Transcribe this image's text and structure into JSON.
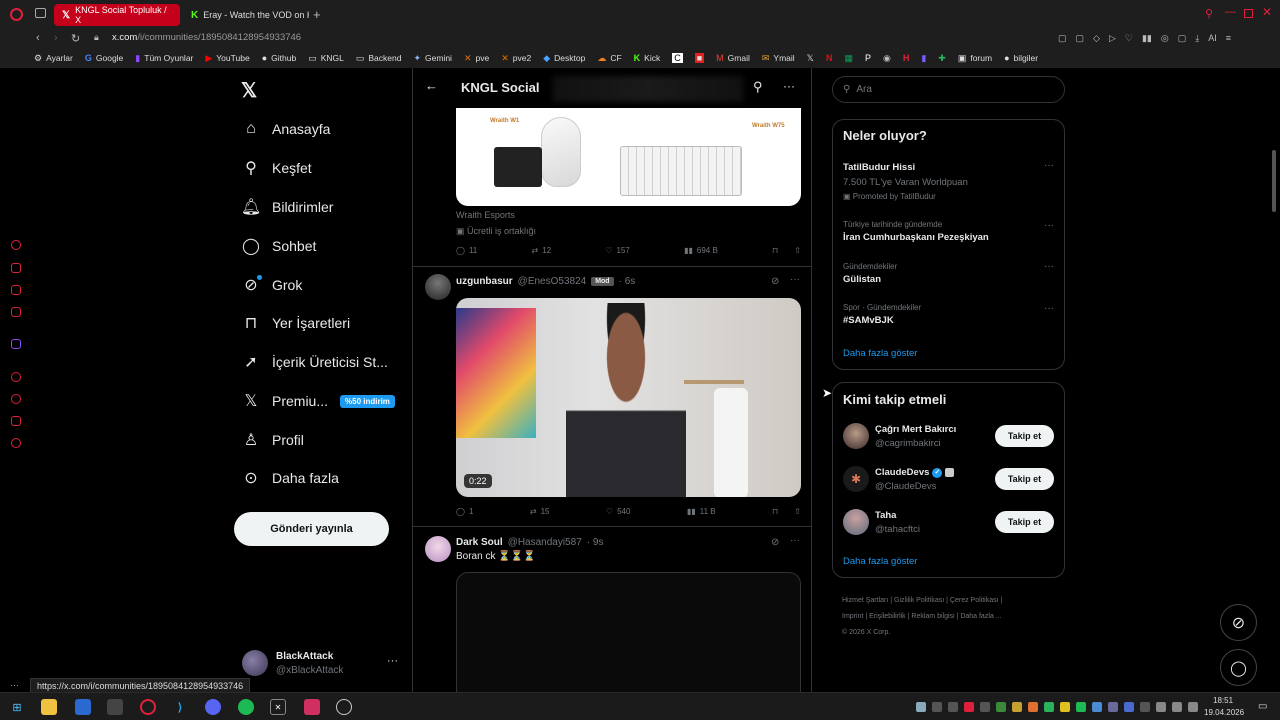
{
  "browser": {
    "tabs": [
      {
        "label": "KNGL Social Topluluk / X",
        "icon": "x-icon"
      },
      {
        "label": "Eray - Watch the VOD on K",
        "icon": "kick-icon"
      }
    ],
    "url_host": "x.com",
    "url_path": "/i/communities/1895084128954933746",
    "status_url": "https://x.com/i/communities/1895084128954933746",
    "bookmarks": [
      {
        "label": "Ayarlar",
        "icon": "gear-icon"
      },
      {
        "label": "Google",
        "icon": "google-icon"
      },
      {
        "label": "Tüm Oyunlar",
        "icon": "twitch-icon"
      },
      {
        "label": "YouTube",
        "icon": "youtube-icon"
      },
      {
        "label": "Github",
        "icon": "github-icon"
      },
      {
        "label": "KNGL",
        "icon": "folder-icon"
      },
      {
        "label": "Backend",
        "icon": "folder-icon"
      },
      {
        "label": "Gemini",
        "icon": "gemini-icon"
      },
      {
        "label": "pve",
        "icon": "proxmox-icon"
      },
      {
        "label": "pve2",
        "icon": "proxmox-icon"
      },
      {
        "label": "Desktop",
        "icon": "desktop-icon"
      },
      {
        "label": "CF",
        "icon": "cloudflare-icon"
      },
      {
        "label": "Kick",
        "icon": "kick-icon"
      },
      {
        "label": "Gmail",
        "icon": "gmail-icon"
      },
      {
        "label": "Ymail",
        "icon": "mail-icon"
      },
      {
        "label": "forum",
        "icon": "forum-icon"
      },
      {
        "label": "bilgiler",
        "icon": "github-icon"
      }
    ],
    "toolbar_ai": "AI"
  },
  "nav": {
    "items": [
      {
        "label": "Anasayfa",
        "icon": "home-icon"
      },
      {
        "label": "Keşfet",
        "icon": "search-icon"
      },
      {
        "label": "Bildirimler",
        "icon": "bell-icon"
      },
      {
        "label": "Sohbet",
        "icon": "chat-icon"
      },
      {
        "label": "Grok",
        "icon": "grok-icon"
      },
      {
        "label": "Yer İşaretleri",
        "icon": "bookmark-icon"
      },
      {
        "label": "İçerik Üreticisi St...",
        "icon": "rocket-icon"
      },
      {
        "label": "Premiu...",
        "icon": "x-logo-icon"
      },
      {
        "label": "Profil",
        "icon": "person-icon"
      },
      {
        "label": "Daha fazla",
        "icon": "more-icon"
      }
    ],
    "premium_badge": "%50 indirim",
    "post_button": "Gönderi yayınla",
    "account": {
      "name": "BlackAttack",
      "handle": "@xBlackAttack"
    }
  },
  "header": {
    "title": "KNGL Social"
  },
  "tweets": [
    {
      "ad_labels": [
        "Wraith W1",
        "Wraith W75"
      ],
      "author": "Wraith Esports",
      "paid": "Ücretli iş ortaklığı",
      "replies": "11",
      "retweets": "12",
      "likes": "157",
      "views": "694 B"
    },
    {
      "author": "uzgunbasur",
      "handle": "@EnesO53824",
      "badge": "Mod",
      "time": "· 6s",
      "video_duration": "0:22",
      "replies": "1",
      "retweets": "15",
      "likes": "540",
      "views": "11 B"
    },
    {
      "author": "Dark Soul",
      "handle": "@Hasandayi587",
      "time": "· 9s",
      "text": "Boran ck ⏳⏳⏳"
    }
  ],
  "right": {
    "search_placeholder": "Ara",
    "trends_title": "Neler oluyor?",
    "trends": [
      {
        "sub": "7.500 TL'ye Varan Worldpuan",
        "name": "TatilBudur Hissi",
        "promo": "Promoted by TatilBudur"
      },
      {
        "sub": "Türkiye tarihinde gündemde",
        "name": "İran Cumhurbaşkanı Pezeşkiyan"
      },
      {
        "sub": "Gündemdekiler",
        "name": "Gülistan"
      },
      {
        "sub": "Spor · Gündemdekiler",
        "name": "#SAMvBJK"
      }
    ],
    "show_more": "Daha fazla göster",
    "follow_title": "Kimi takip etmeli",
    "follow": [
      {
        "name": "Çağrı Mert Bakırcı",
        "handle": "@cagrimbakirci"
      },
      {
        "name": "ClaudeDevs",
        "handle": "@ClaudeDevs"
      },
      {
        "name": "Taha",
        "handle": "@tahacftci"
      }
    ],
    "follow_button": "Takip et",
    "footer": [
      "Hizmet Şartları",
      "Gizlilik Politikası",
      "Çerez Politikası",
      "Imprint",
      "Erişilebilirlik",
      "Reklam bilgisi",
      "Daha fazla ...",
      "© 2026 X Corp."
    ]
  },
  "taskbar": {
    "time": "18:51",
    "date": "19.04.2026"
  }
}
